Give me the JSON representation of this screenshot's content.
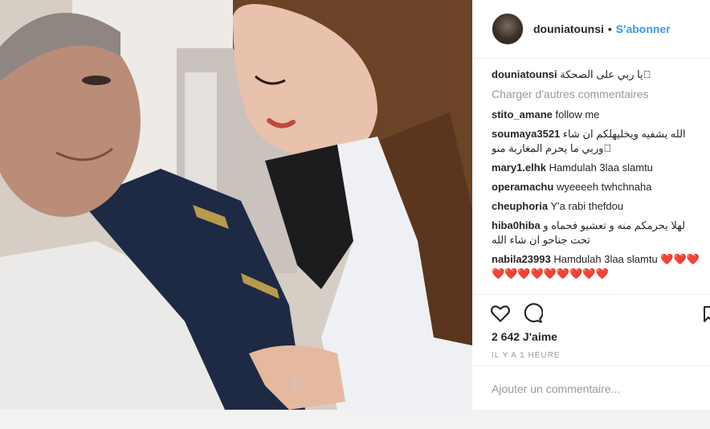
{
  "header": {
    "username": "douniatounsi",
    "separator": "•",
    "follow_label": "S'abonner"
  },
  "caption": {
    "user": "douniatounsi",
    "text": "يا ربي على الصحكة 🏻"
  },
  "load_more_label": "Charger d'autres commentaires",
  "comments": [
    {
      "user": "stito_amane",
      "text": "follow me"
    },
    {
      "user": "soumaya3521",
      "text": "الله يشفيه ويخليهلكم ان شاء وربي ما يحرم المغاربة منو 🏻"
    },
    {
      "user": "mary1.elhk",
      "text": "Hamdulah 3laa slamtu"
    },
    {
      "user": "operamachu",
      "text": "wyeeeeh twhchnaha"
    },
    {
      "user": "cheuphoria",
      "text": "Y'a rabi thefdou"
    },
    {
      "user": "hiba0hiba",
      "text": "لهلا يحرمكم منه و تعشيو فحماه و تحت جناحو ان شاء الله"
    },
    {
      "user": "nabila23993",
      "text": "Hamdulah 3laa slamtu ❤️❤️❤️❤️❤️❤️❤️❤️❤️❤️❤️❤️"
    }
  ],
  "likes": "2 642 J'aime",
  "timestamp": "IL Y A 1 HEURE",
  "add_comment_placeholder": "Ajouter un commentaire...",
  "icons": {
    "like": "heart-icon",
    "comment": "comment-icon",
    "save": "bookmark-icon"
  }
}
